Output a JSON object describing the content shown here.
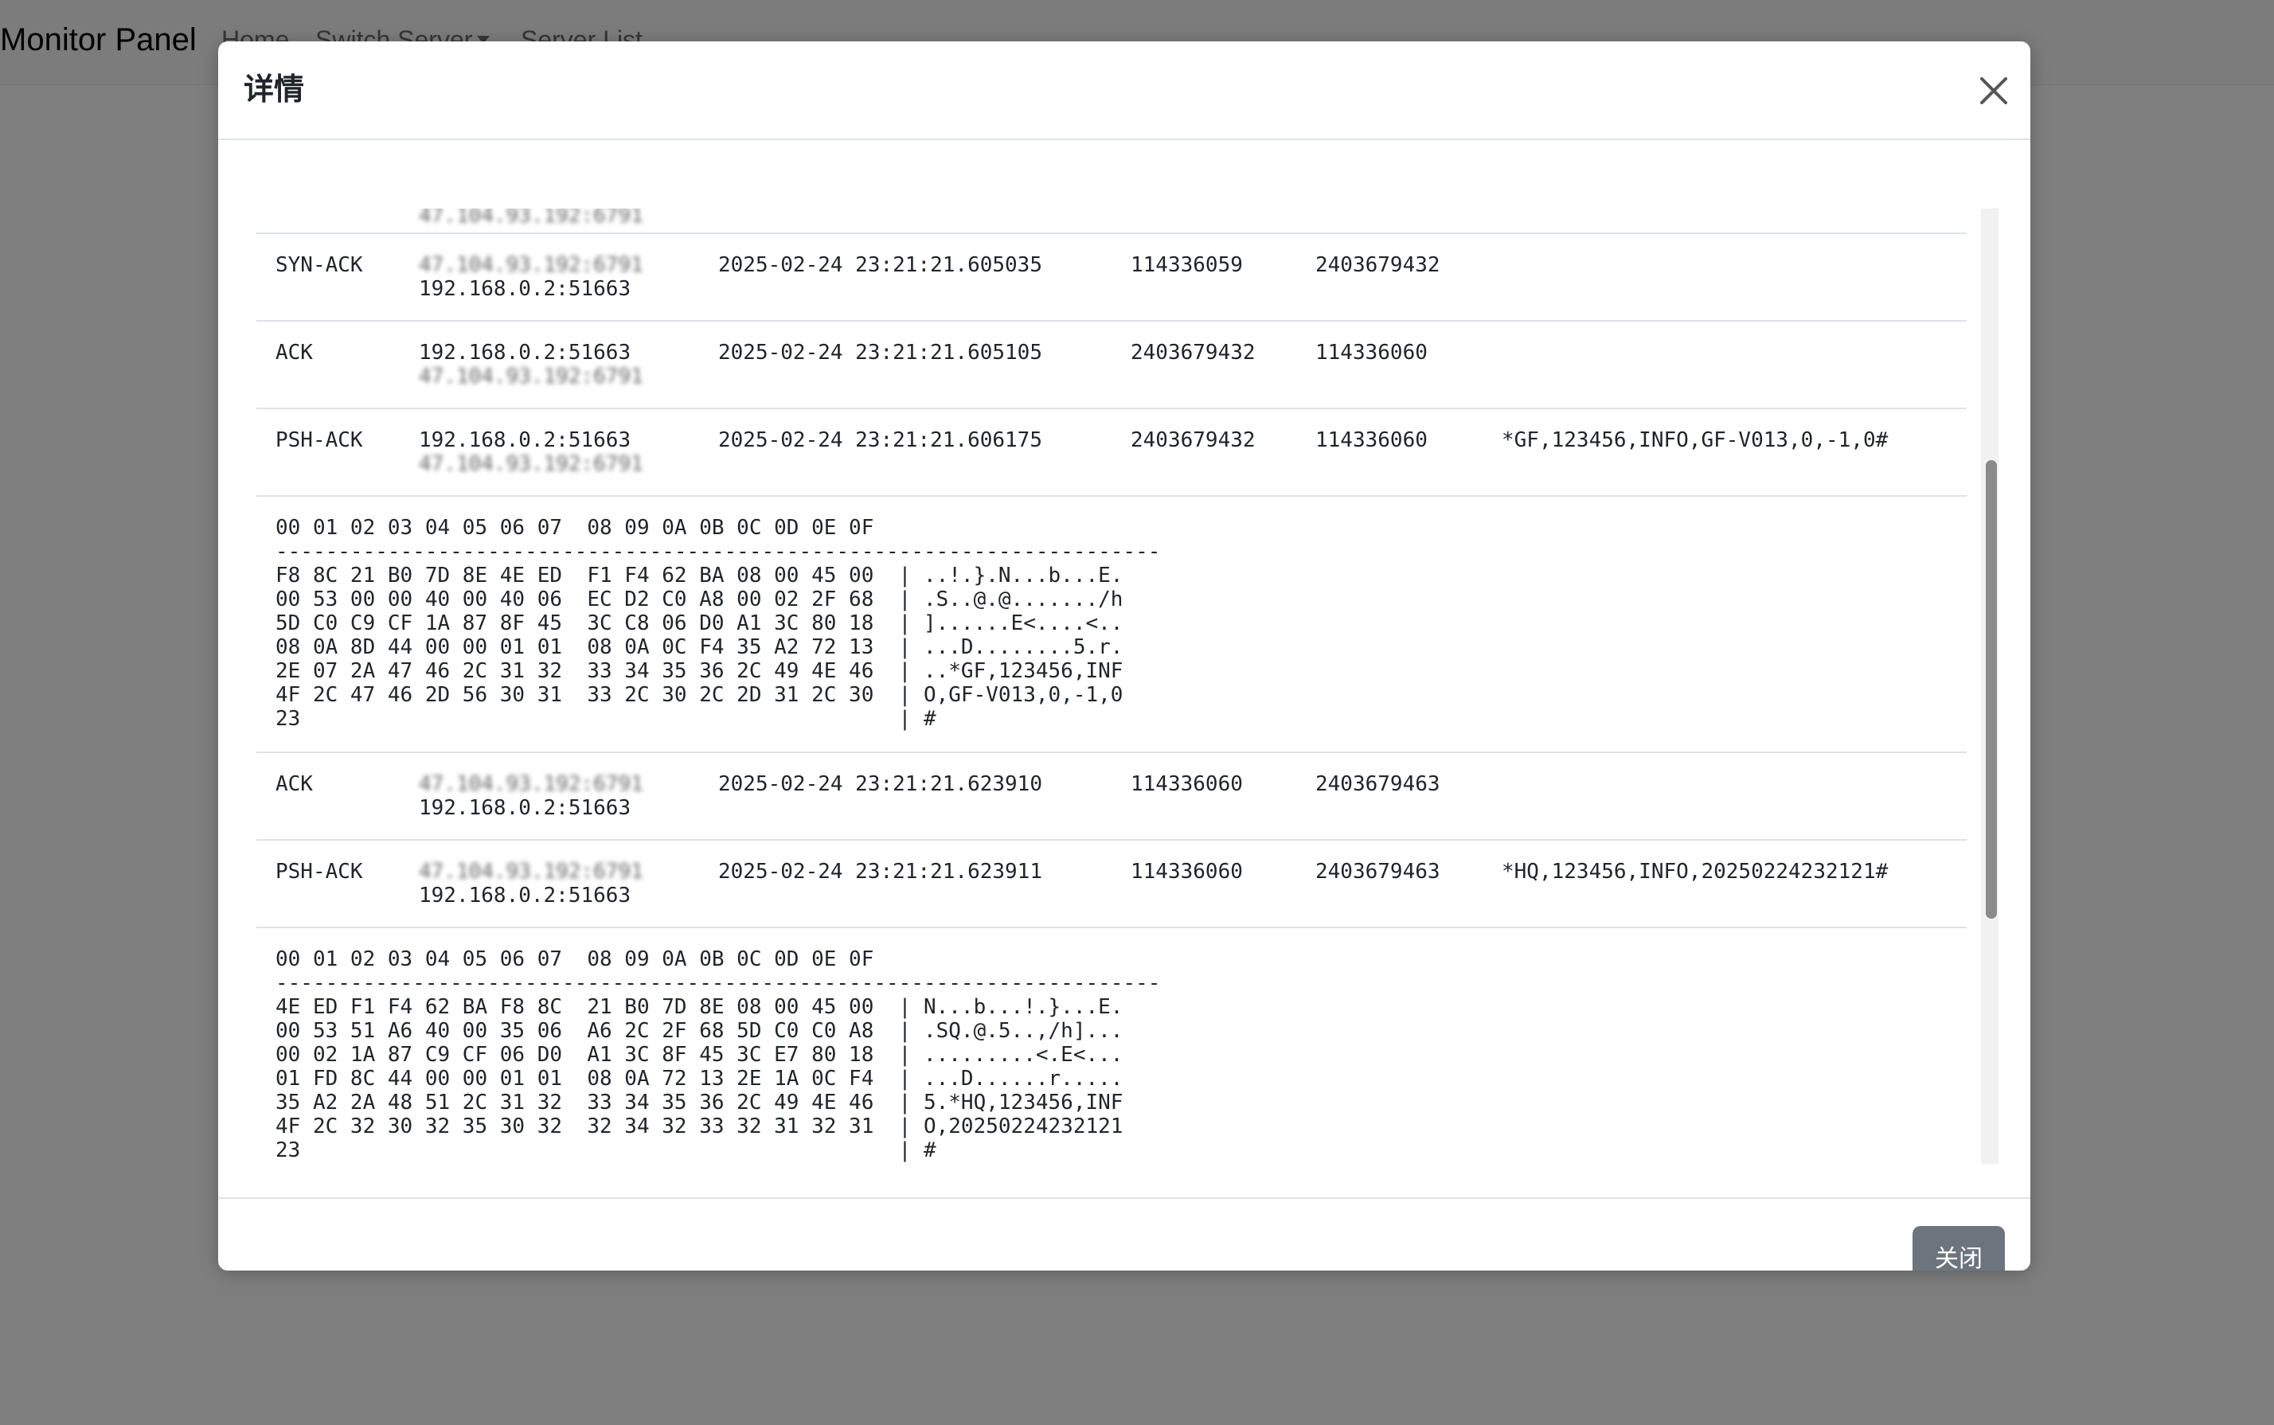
{
  "app": {
    "brand": "Monitor Panel",
    "nav": {
      "home": "Home",
      "switch_server": "Switch Server",
      "server_list": "Server List"
    }
  },
  "modal": {
    "title": "详情",
    "close_label": "关闭",
    "partial_top_address": "47.104.93.192:6791",
    "packets": [
      {
        "type": "SYN-ACK",
        "src": "47.104.93.192:6791",
        "dst": "192.168.0.2:51663",
        "src_masked": true,
        "time": "2025-02-24 23:21:21.605035",
        "seq": "114336059",
        "ack": "2403679432",
        "data": ""
      },
      {
        "type": "ACK",
        "src": "192.168.0.2:51663",
        "dst": "47.104.93.192:6791",
        "src_masked": false,
        "time": "2025-02-24 23:21:21.605105",
        "seq": "2403679432",
        "ack": "114336060",
        "data": ""
      },
      {
        "type": "PSH-ACK",
        "src": "192.168.0.2:51663",
        "dst": "47.104.93.192:6791",
        "src_masked": false,
        "time": "2025-02-24 23:21:21.606175",
        "seq": "2403679432",
        "ack": "114336060",
        "data": "*GF,123456,INFO,GF-V013,0,-1,0#"
      },
      {
        "type": "ACK",
        "src": "47.104.93.192:6791",
        "dst": "192.168.0.2:51663",
        "src_masked": true,
        "time": "2025-02-24 23:21:21.623910",
        "seq": "114336060",
        "ack": "2403679463",
        "data": ""
      },
      {
        "type": "PSH-ACK",
        "src": "47.104.93.192:6791",
        "dst": "192.168.0.2:51663",
        "src_masked": true,
        "time": "2025-02-24 23:21:21.623911",
        "seq": "114336060",
        "ack": "2403679463",
        "data": "*HQ,123456,INFO,20250224232121#"
      }
    ],
    "hex_dumps": [
      {
        "header": "00 01 02 03 04 05 06 07  08 09 0A 0B 0C 0D 0E 0F",
        "separator": "-----------------------------------------------------------------------",
        "lines": [
          "F8 8C 21 B0 7D 8E 4E ED  F1 F4 62 BA 08 00 45 00  | ..!.}.N...b...E.",
          "00 53 00 00 40 00 40 06  EC D2 C0 A8 00 02 2F 68  | .S..@.@......./h",
          "5D C0 C9 CF 1A 87 8F 45  3C C8 06 D0 A1 3C 80 18  | ]......E<....<..",
          "08 0A 8D 44 00 00 01 01  08 0A 0C F4 35 A2 72 13  | ...D........5.r.",
          "2E 07 2A 47 46 2C 31 32  33 34 35 36 2C 49 4E 46  | ..*GF,123456,INF",
          "4F 2C 47 46 2D 56 30 31  33 2C 30 2C 2D 31 2C 30  | O,GF-V013,0,-1,0",
          "23                                                | #"
        ]
      },
      {
        "header": "00 01 02 03 04 05 06 07  08 09 0A 0B 0C 0D 0E 0F",
        "separator": "-----------------------------------------------------------------------",
        "lines": [
          "4E ED F1 F4 62 BA F8 8C  21 B0 7D 8E 08 00 45 00  | N...b...!.}...E.",
          "00 53 51 A6 40 00 35 06  A6 2C 2F 68 5D C0 C0 A8  | .SQ.@.5..,/h]...",
          "00 02 1A 87 C9 CF 06 D0  A1 3C 8F 45 3C E7 80 18  | .........<.E<...",
          "01 FD 8C 44 00 00 01 01  08 0A 72 13 2E 1A 0C F4  | ...D......r.....",
          "35 A2 2A 48 51 2C 31 32  33 34 35 36 2C 49 4E 46  | 5.*HQ,123456,INF",
          "4F 2C 32 30 32 35 30 32  32 34 32 33 32 31 32 31  | O,20250224232121",
          "23                                                | #"
        ]
      }
    ]
  }
}
